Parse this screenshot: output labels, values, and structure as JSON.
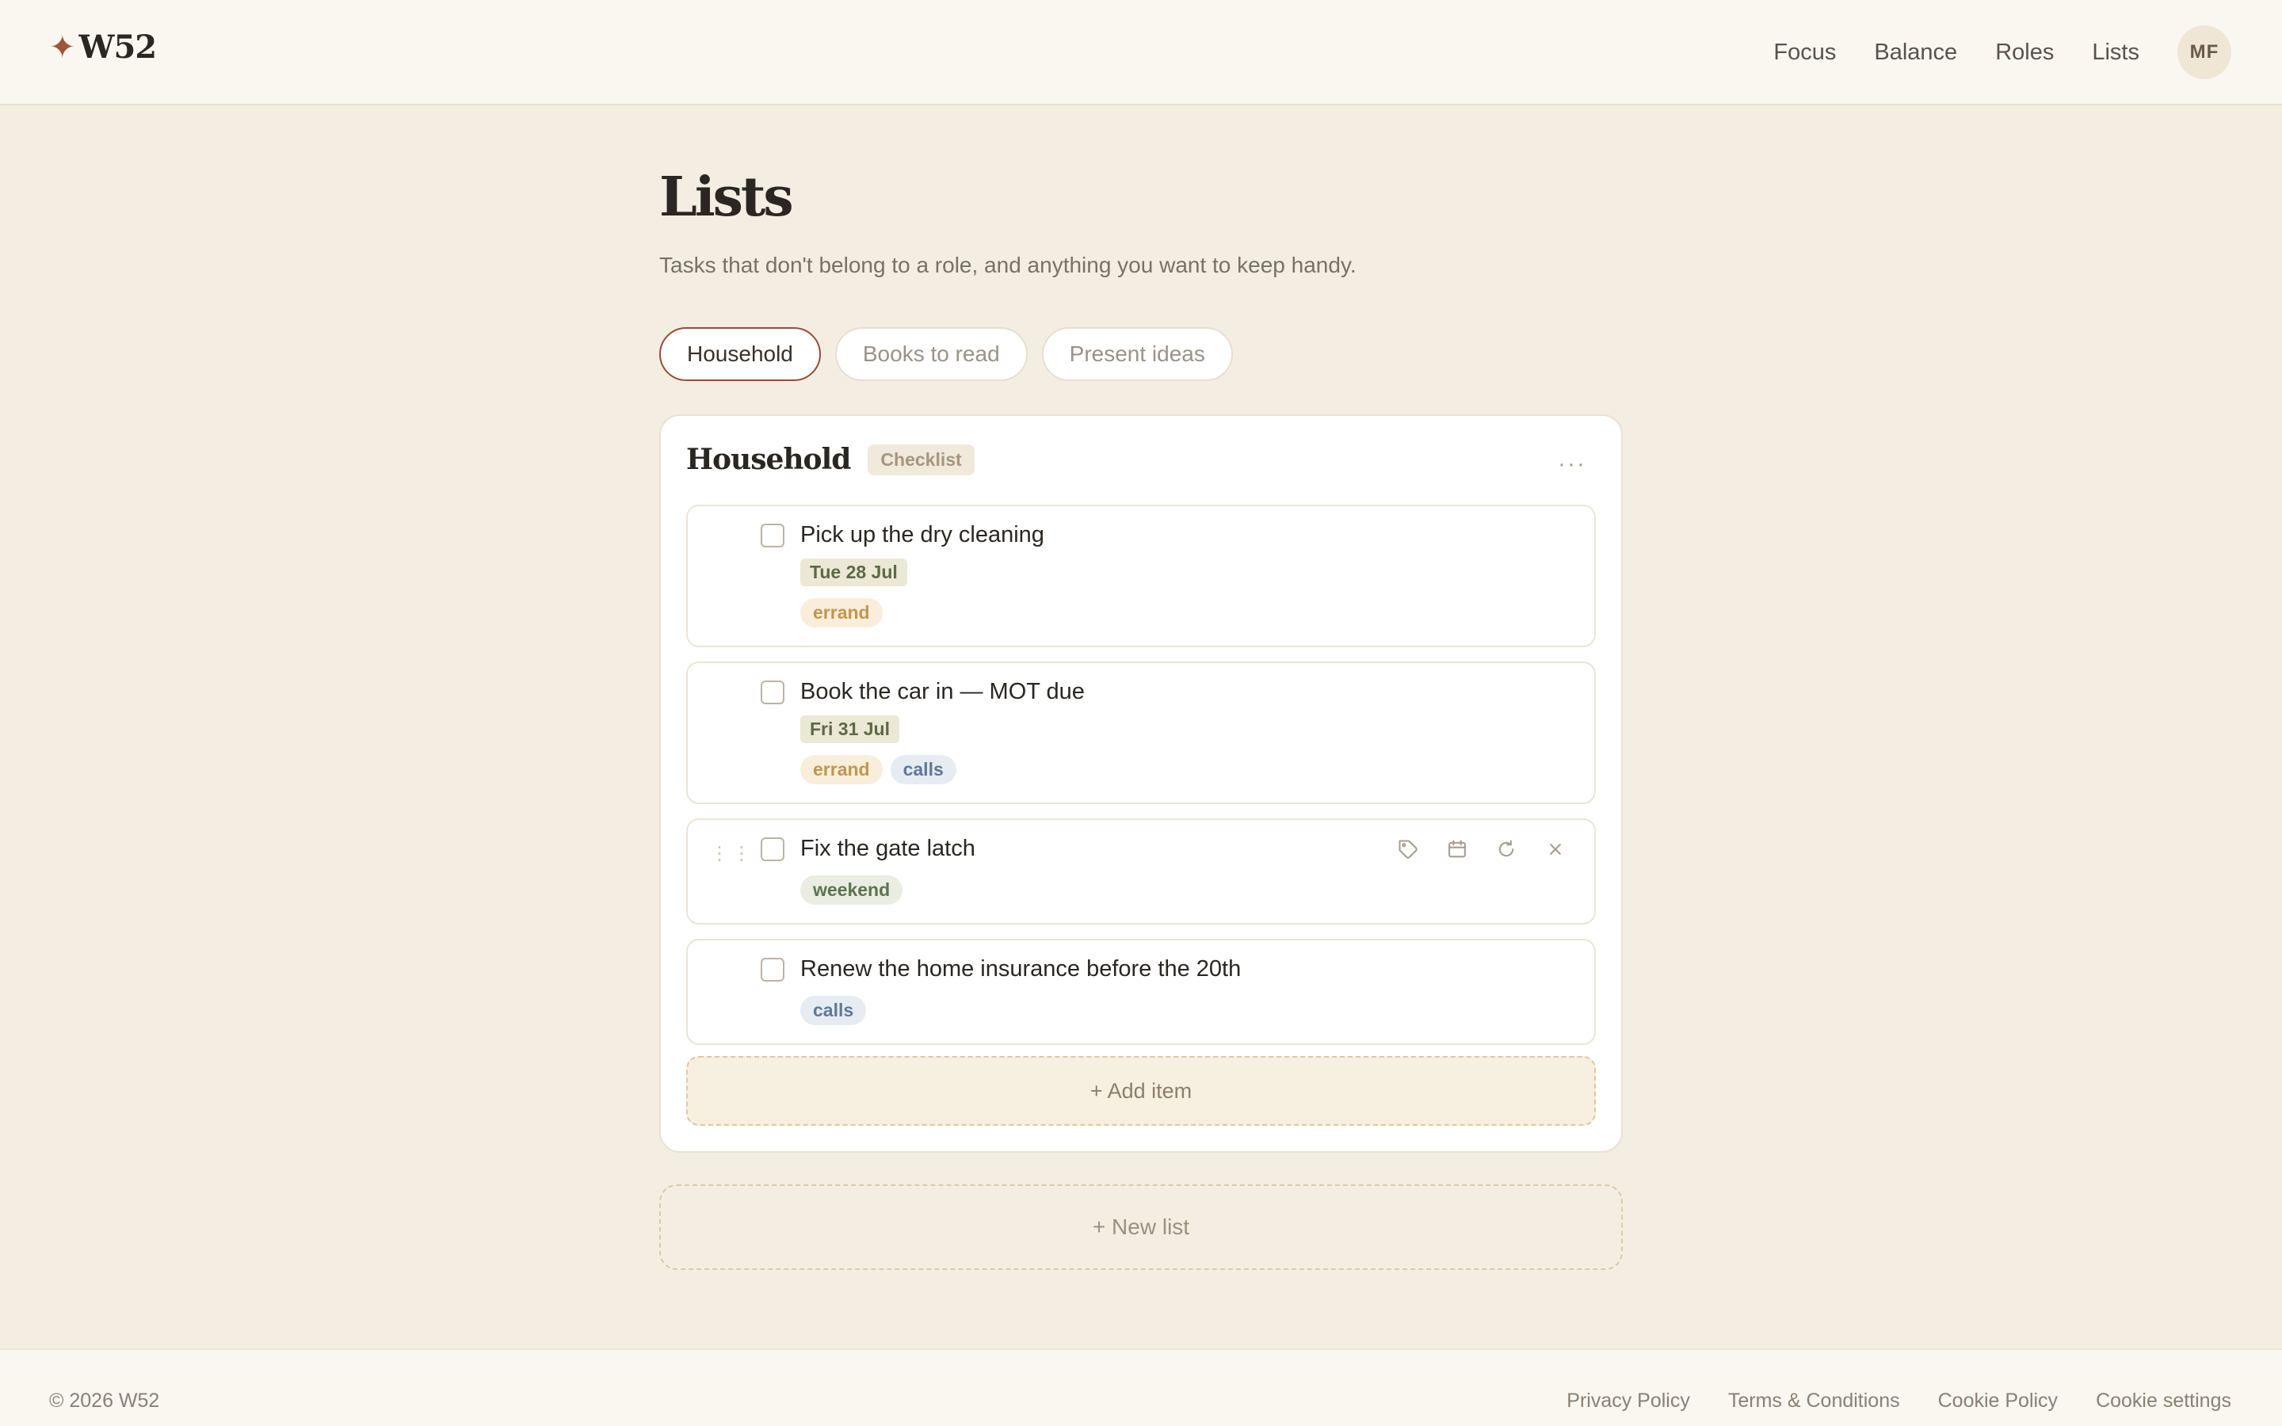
{
  "brand": {
    "mark": "✦",
    "name": "W52"
  },
  "nav": {
    "items": [
      {
        "label": "Focus"
      },
      {
        "label": "Balance"
      },
      {
        "label": "Roles"
      },
      {
        "label": "Lists"
      }
    ],
    "avatar_initials": "MF"
  },
  "page": {
    "title": "Lists",
    "subtitle": "Tasks that don't belong to a role, and anything you want to keep handy."
  },
  "tabs": [
    {
      "label": "Household",
      "active": true
    },
    {
      "label": "Books to read",
      "active": false
    },
    {
      "label": "Present ideas",
      "active": false
    }
  ],
  "list": {
    "title": "Household",
    "badge": "Checklist",
    "menu_icon": "more-horizontal-icon",
    "items": [
      {
        "text": "Pick up the dry cleaning",
        "date": "Tue 28 Jul",
        "tags": [
          "errand"
        ]
      },
      {
        "text": "Book the car in — MOT due",
        "date": "Fri 31 Jul",
        "tags": [
          "errand",
          "calls"
        ]
      },
      {
        "text": "Fix the gate latch",
        "tags": [
          "weekend"
        ],
        "hovered": true
      },
      {
        "text": "Renew the home insurance before the 20th",
        "tags": [
          "calls"
        ]
      }
    ],
    "add_item_label": "+ Add item"
  },
  "new_list_label": "+ New list",
  "footer": {
    "copyright": "© 2026 W52",
    "links": [
      "Privacy Policy",
      "Terms & Conditions",
      "Cookie Policy",
      "Cookie settings"
    ]
  },
  "colors": {
    "background": "#f4eee2",
    "accent": "#9b4a33",
    "tag_errand": "#c2964e",
    "tag_calls": "#5e7898",
    "tag_weekend": "#5d7350"
  }
}
